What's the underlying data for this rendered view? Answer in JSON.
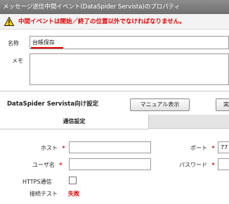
{
  "window": {
    "title": "メッセージ送信中間イベント(DataSpider Servista)のプロパティ"
  },
  "warning": {
    "text": "中間イベントは開始／終了の位置以外でなければなりません。",
    "color": "#e00000"
  },
  "form": {
    "name_label": "名称",
    "name_value": "台帳保存",
    "memo_label": "メモ",
    "memo_value": ""
  },
  "section": {
    "title": "DataSpider Servista向け設定",
    "manual_button": "マニュアル表示",
    "next_button_partial": "実"
  },
  "tabs": [
    {
      "label": "通信設定",
      "active": true
    },
    {
      "label": "",
      "active": false
    }
  ],
  "fields": {
    "host_label": "ホスト",
    "host_value": "",
    "port_label": "ポート",
    "port_value": "77",
    "user_label": "ユーザ名",
    "user_value": "",
    "password_label": "パスワード",
    "password_value": "",
    "required_mark": "*",
    "https_label": "HTTPS通信",
    "https_checked": false,
    "test_label": "接続テスト",
    "test_result": "失敗"
  },
  "icons": {
    "warning": "warning-triangle-icon"
  }
}
